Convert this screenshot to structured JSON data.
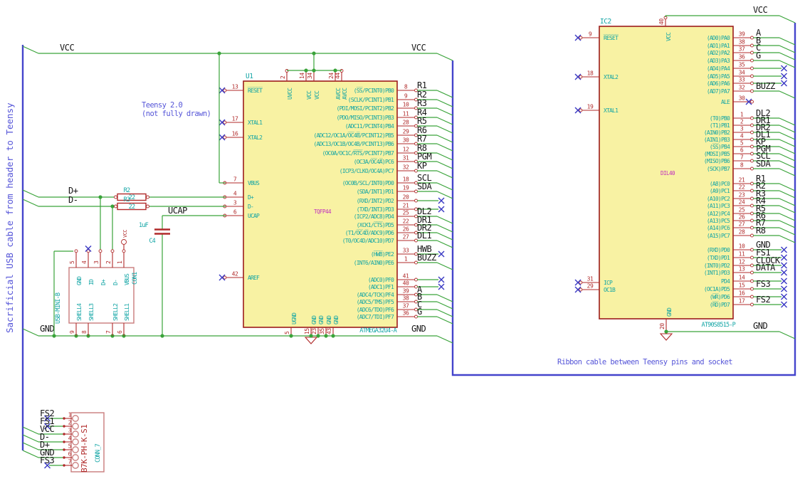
{
  "notes": {
    "teensy_1": "Teensy 2.0",
    "teensy_2": "(not fully drawn)",
    "ribbon": "Ribbon cable between Teensy pins and socket",
    "sacrificial": "Sacrificial USB cable from header to Teensy"
  },
  "net_labels": {
    "vcc": "VCC",
    "gnd": "GND",
    "d_plus": "D+",
    "d_minus": "D-",
    "ucap": "UCAP"
  },
  "u1": {
    "ref": "U1",
    "value": "ATMEGA32U4-A",
    "package": "TQFP44",
    "left_pins": [
      {
        "num": "13",
        "name": "R̅E̅S̅E̅T̅",
        "end": "nc"
      },
      {
        "num": "17",
        "name": "XTAL1",
        "end": "nc"
      },
      {
        "num": "16",
        "name": "XTAL2",
        "end": "nc"
      },
      {
        "num": "7",
        "name": "VBUS",
        "end": "wire"
      },
      {
        "num": "4",
        "name": "D+",
        "end": "wire"
      },
      {
        "num": "3",
        "name": "D-",
        "end": "wire"
      },
      {
        "num": "6",
        "name": "UCAP",
        "end": "wire"
      },
      {
        "num": "42",
        "name": "AREF",
        "end": "nc"
      }
    ],
    "right_pins": [
      {
        "num": "8",
        "name": "(S̅S̅/PCINT0)PB0",
        "net": "R1",
        "end": "bus"
      },
      {
        "num": "9",
        "name": "(SCLK/PCINT1)PB1",
        "net": "R2",
        "end": "bus"
      },
      {
        "num": "10",
        "name": "(PDI/MOSI/PCINT2)PB2",
        "net": "R3",
        "end": "bus"
      },
      {
        "num": "11",
        "name": "(PDO/MISO/PCINT3)PB3",
        "net": "R4",
        "end": "bus"
      },
      {
        "num": "28",
        "name": "(ADC11/PCINT4)PB4",
        "net": "R5",
        "end": "bus"
      },
      {
        "num": "29",
        "name": "(ADC12/OC1A/O̅C̅4̅B̅/PCINT12)PB5",
        "net": "R6",
        "end": "bus"
      },
      {
        "num": "30",
        "name": "(ADC13/OC1B/OC4B/PCINT13)PB6",
        "net": "R7",
        "end": "bus"
      },
      {
        "num": "12",
        "name": "(OC0A/OC1C/R̅T̅S̅/PCINT7)PB7",
        "net": "R8",
        "end": "bus"
      },
      {
        "num": "31",
        "name": "(OC3A/O̅C̅4̅A̅)PC6",
        "net": "PGM",
        "end": "bus"
      },
      {
        "num": "32",
        "name": "(ICP3/CLKO/OC4A)PC7",
        "net": "KP",
        "end": "bus"
      },
      {
        "num": "18",
        "name": "(OC0B/SCL/INT0)PD0",
        "net": "SCL",
        "end": "bus"
      },
      {
        "num": "19",
        "name": "(SDA/INT1)PD1",
        "net": "SDA",
        "end": "bus"
      },
      {
        "num": "20",
        "name": "(RXD/INT2)PD2",
        "net": "",
        "end": "nc"
      },
      {
        "num": "21",
        "name": "(TXD/INT3)PD3",
        "net": "",
        "end": "nc"
      },
      {
        "num": "25",
        "name": "(ICP2/ADC8)PD4",
        "net": "DL2",
        "end": "bus"
      },
      {
        "num": "22",
        "name": "(XCK1/C̅T̅S̅)PD5",
        "net": "DR1",
        "end": "bus"
      },
      {
        "num": "26",
        "name": "(T1/O̅C̅4̅D̅/ADC9)PD6",
        "net": "DR2",
        "end": "bus"
      },
      {
        "num": "27",
        "name": "(T0/OC4D/ADC10)PD7",
        "net": "DL1",
        "end": "bus"
      },
      {
        "num": "33",
        "name": "(H̅W̅B̅)PE2",
        "net": "HWB",
        "end": "nc"
      },
      {
        "num": "1",
        "name": "(INT6/AIN0)PE6",
        "net": "BUZZ",
        "end": "bus"
      },
      {
        "num": "41",
        "name": "(ADC0)PF0",
        "net": "",
        "end": "nc"
      },
      {
        "num": "40",
        "name": "(ADC1)PF1",
        "net": "",
        "end": "nc"
      },
      {
        "num": "39",
        "name": "(ADC4/TCK)PF4",
        "net": "A",
        "end": "bus"
      },
      {
        "num": "38",
        "name": "(ADC5/TMS)PF5",
        "net": "B",
        "end": "bus"
      },
      {
        "num": "37",
        "name": "(ADC6/TDO)PF6",
        "net": "C",
        "end": "bus"
      },
      {
        "num": "36",
        "name": "(ADC7/TDI)PF7",
        "net": "G",
        "end": "bus"
      }
    ],
    "top_pins": [
      {
        "num": "2",
        "name": "UVCC"
      },
      {
        "num": "14",
        "name": "VCC"
      },
      {
        "num": "34",
        "name": "VCC"
      },
      {
        "num": "24",
        "name": "AVCC"
      },
      {
        "num": "44",
        "name": "AVCC"
      }
    ],
    "bottom_pins": [
      {
        "num": "5",
        "name": "UGND"
      },
      {
        "num": "15",
        "name": "GND"
      },
      {
        "num": "23",
        "name": "GND"
      },
      {
        "num": "35",
        "name": "GND"
      },
      {
        "num": "43",
        "name": "GND"
      }
    ]
  },
  "ic2": {
    "ref": "IC2",
    "value": "AT90S8515-P",
    "package": "DIL40",
    "top_pin": {
      "num": "40",
      "name": "VCC"
    },
    "bottom_pin": {
      "num": "20",
      "name": "GND"
    },
    "left_pins": [
      {
        "num": "9",
        "name": "R̅E̅S̅E̅T̅",
        "end": "nc"
      },
      {
        "num": "18",
        "name": "XTAL2",
        "end": "nc"
      },
      {
        "num": "19",
        "name": "XTAL1",
        "end": "nc"
      },
      {
        "num": "31",
        "name": "ICP",
        "end": "nc"
      },
      {
        "num": "29",
        "name": "OC1B",
        "end": "nc"
      }
    ],
    "right_pins": [
      {
        "num": "39",
        "name": "(AD0)PA0",
        "net": "A",
        "end": "bus"
      },
      {
        "num": "38",
        "name": "(AD1)PA1",
        "net": "B",
        "end": "bus"
      },
      {
        "num": "37",
        "name": "(AD2)PA2",
        "net": "C",
        "end": "bus"
      },
      {
        "num": "36",
        "name": "(AD3)PA3",
        "net": "G",
        "end": "bus"
      },
      {
        "num": "35",
        "name": "(AD4)PA4",
        "net": "",
        "end": "nc"
      },
      {
        "num": "34",
        "name": "(AD5)PA5",
        "net": "",
        "end": "nc"
      },
      {
        "num": "33",
        "name": "(AD6)PA6",
        "net": "",
        "end": "nc"
      },
      {
        "num": "32",
        "name": "(AD7)PA7",
        "net": "BUZZ",
        "end": "bus"
      },
      {
        "num": "30",
        "name": "ALE",
        "net": "",
        "end": "ncpin"
      },
      {
        "num": "1",
        "name": "(T0)PB0",
        "net": "DL2",
        "end": "bus"
      },
      {
        "num": "2",
        "name": "(T1)PB1",
        "net": "DR1",
        "end": "bus"
      },
      {
        "num": "3",
        "name": "(AIN0)PB2",
        "net": "DR2",
        "end": "bus"
      },
      {
        "num": "4",
        "name": "(AIN1)PB3",
        "net": "DL1",
        "end": "bus"
      },
      {
        "num": "5",
        "name": "(S̅S̅)PB4",
        "net": "KP",
        "end": "bus"
      },
      {
        "num": "6",
        "name": "(MOSI)PB5",
        "net": "PGM",
        "end": "bus"
      },
      {
        "num": "7",
        "name": "(MISO)PB6",
        "net": "SCL",
        "end": "bus"
      },
      {
        "num": "8",
        "name": "(SCK)PB7",
        "net": "SDA",
        "end": "bus"
      },
      {
        "num": "21",
        "name": "(A8)PC0",
        "net": "R1",
        "end": "bus"
      },
      {
        "num": "22",
        "name": "(A9)PC1",
        "net": "R2",
        "end": "bus"
      },
      {
        "num": "23",
        "name": "(A10)PC2",
        "net": "R3",
        "end": "bus"
      },
      {
        "num": "24",
        "name": "(A11)PC3",
        "net": "R4",
        "end": "bus"
      },
      {
        "num": "25",
        "name": "(A12)PC4",
        "net": "R5",
        "end": "bus"
      },
      {
        "num": "26",
        "name": "(A13)PC5",
        "net": "R6",
        "end": "bus"
      },
      {
        "num": "27",
        "name": "(A14)PC6",
        "net": "R7",
        "end": "bus"
      },
      {
        "num": "28",
        "name": "(A15)PC7",
        "net": "R8",
        "end": "bus"
      },
      {
        "num": "10",
        "name": "(RXD)PD0",
        "net": "GND",
        "end": "nc"
      },
      {
        "num": "11",
        "name": "(TXD)PD1",
        "net": "FS1",
        "end": "nc"
      },
      {
        "num": "12",
        "name": "(INT0)PD2",
        "net": "CLOCK",
        "end": "nc"
      },
      {
        "num": "13",
        "name": "(INT1)PD3",
        "net": "DATA",
        "end": "nc"
      },
      {
        "num": "14",
        "name": "PD4",
        "net": "",
        "end": "nc"
      },
      {
        "num": "15",
        "name": "(OC1A)PD5",
        "net": "FS3",
        "end": "nc"
      },
      {
        "num": "16",
        "name": "(W̅R̅)PD6",
        "net": "",
        "end": "nc"
      },
      {
        "num": "17",
        "name": "(R̅D̅)PD7",
        "net": "FS2",
        "end": "nc"
      }
    ]
  },
  "r2": {
    "ref": "R2",
    "value": "22"
  },
  "r3": {
    "ref": "R3",
    "value": "22"
  },
  "c4": {
    "ref": "C4",
    "value": "1uF"
  },
  "usb": {
    "ref": "CON1",
    "value": "USB-MINI-B",
    "vcc_flag": "VCC",
    "top_pins": [
      {
        "num": "5",
        "name": "GND",
        "end": "wire"
      },
      {
        "num": "4",
        "name": "ID",
        "end": "nc"
      },
      {
        "num": "3",
        "name": "D+",
        "end": "wire"
      },
      {
        "num": "2",
        "name": "D-",
        "end": "wire"
      },
      {
        "num": "1",
        "name": "VBUS",
        "end": "vcc"
      }
    ],
    "bottom_pins": [
      {
        "num": "9",
        "name": "SHELL4"
      },
      {
        "num": "8",
        "name": "SHELL3"
      },
      {
        "num": "7",
        "name": "SHELL2"
      },
      {
        "num": "6",
        "name": "SHELL1"
      }
    ]
  },
  "conn7": {
    "ref": "CONN_7",
    "value": "B7K-PH-K-S1",
    "pins": [
      {
        "num": "1",
        "label": "FS2",
        "end": "nc"
      },
      {
        "num": "2",
        "label": "FS1",
        "end": "nc"
      },
      {
        "num": "3",
        "label": "VCC",
        "end": "bus"
      },
      {
        "num": "4",
        "label": "D-",
        "end": "bus"
      },
      {
        "num": "5",
        "label": "D+",
        "end": "bus"
      },
      {
        "num": "6",
        "label": "GND",
        "end": "bus"
      },
      {
        "num": "7",
        "label": "FS3",
        "end": "nc"
      }
    ]
  },
  "colors": {
    "wire": "#3aa33a",
    "bus": "#4444cc",
    "pin": "#b02a2a",
    "pin_name": "#12a5a5",
    "package_text": "#bf2abf",
    "label": "#161616",
    "no_connect": "#3b3bc4",
    "note": "#5555d8",
    "ic_fill": "#f8f2a3",
    "ic_border": "#9c1c1c",
    "connector": "#c97c7c"
  }
}
